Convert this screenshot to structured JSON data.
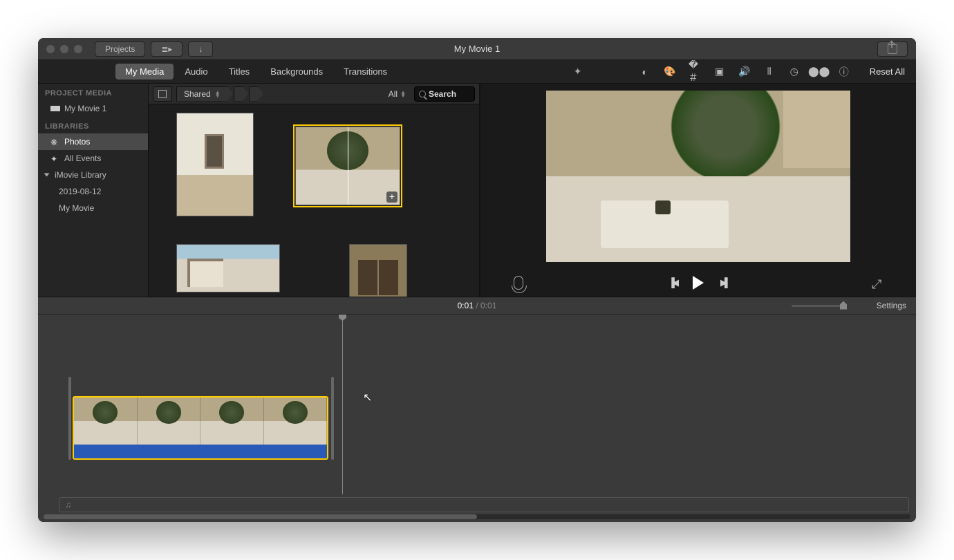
{
  "window": {
    "title": "My Movie 1"
  },
  "titlebar": {
    "projects": "Projects"
  },
  "tabs": {
    "items": [
      {
        "label": "My Media",
        "active": true
      },
      {
        "label": "Audio"
      },
      {
        "label": "Titles"
      },
      {
        "label": "Backgrounds"
      },
      {
        "label": "Transitions"
      }
    ]
  },
  "viewer_tools": {
    "reset": "Reset All"
  },
  "sidebar": {
    "project_media_header": "PROJECT MEDIA",
    "project_name": "My Movie 1",
    "libraries_header": "LIBRARIES",
    "photos": "Photos",
    "all_events": "All Events",
    "imovie_library": "iMovie Library",
    "event_date": "2019-08-12",
    "event_movie": "My Movie"
  },
  "browser": {
    "crumb": "Shared",
    "filter": "All",
    "search_placeholder": "Search"
  },
  "timeline": {
    "current": "0:01",
    "sep": " / ",
    "duration": "0:01",
    "settings": "Settings"
  }
}
